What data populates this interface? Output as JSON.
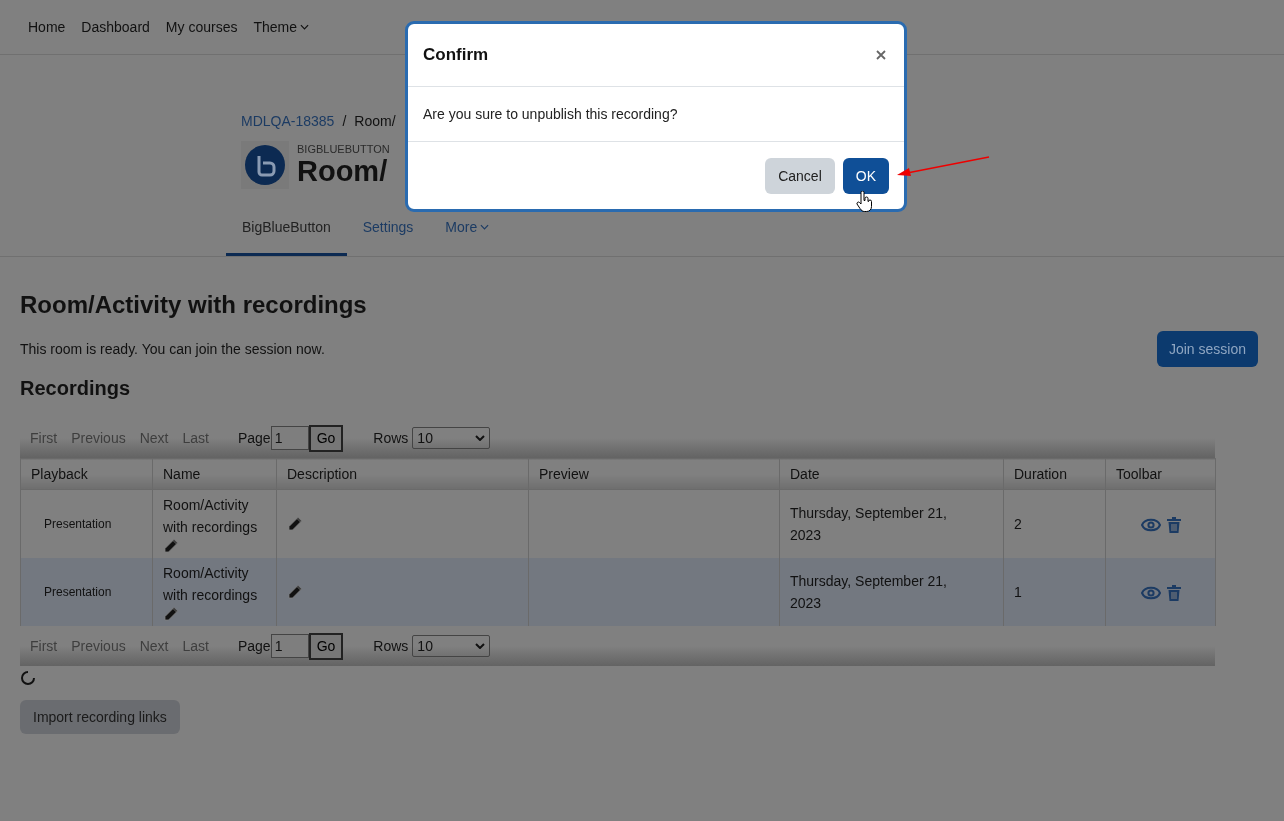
{
  "nav": [
    {
      "label": "Home",
      "menu": false
    },
    {
      "label": "Dashboard",
      "menu": false
    },
    {
      "label": "My courses",
      "menu": false
    },
    {
      "label": "Theme",
      "menu": true
    }
  ],
  "header": {
    "breadcrumb": [
      "MDLQA-18385",
      "Room/"
    ],
    "breadcrumb_separator": "/",
    "module_label": "BIGBLUEBUTTON",
    "title": "Room/"
  },
  "tabs": [
    {
      "label": "BigBlueButton",
      "selected": true,
      "menu": false
    },
    {
      "label": "Settings",
      "selected": false,
      "menu": false
    },
    {
      "label": "More",
      "selected": false,
      "menu": true
    }
  ],
  "heading": "Room/Activity with recordings",
  "status_text": "This room is ready. You can join the session now.",
  "join_button": "Join session",
  "recordings_heading": "Recordings",
  "pager_top": {
    "links": [
      "First",
      "Previous",
      "Next",
      "Last"
    ],
    "page_label": "Page",
    "page_value": "1",
    "go": "Go",
    "rows_label": "Rows",
    "rows_value": "10"
  },
  "table": {
    "columns": [
      "Playback",
      "Name",
      "Description",
      "Preview",
      "Date",
      "Duration",
      "Toolbar"
    ],
    "rows": [
      {
        "playback": "Presentation",
        "name": "Room/Activity with recordings",
        "date": "Thursday, September 21, 2023",
        "duration": "2",
        "selected": false
      },
      {
        "playback": "Presentation",
        "name": "Room/Activity with recordings",
        "date": "Thursday, September 21, 2023",
        "duration": "1",
        "selected": true
      }
    ]
  },
  "pager_bottom": {
    "links": [
      "First",
      "Previous",
      "Next",
      "Last"
    ],
    "page_label": "Page",
    "page_value": "1",
    "go": "Go",
    "rows_label": "Rows",
    "rows_value": "10"
  },
  "import_button": "Import recording links",
  "dialog": {
    "title": "Confirm",
    "message": "Are you sure to unpublish this recording?",
    "buttons": [
      {
        "label": "Cancel",
        "kind": "secondary"
      },
      {
        "label": "OK",
        "kind": "primary"
      }
    ]
  }
}
